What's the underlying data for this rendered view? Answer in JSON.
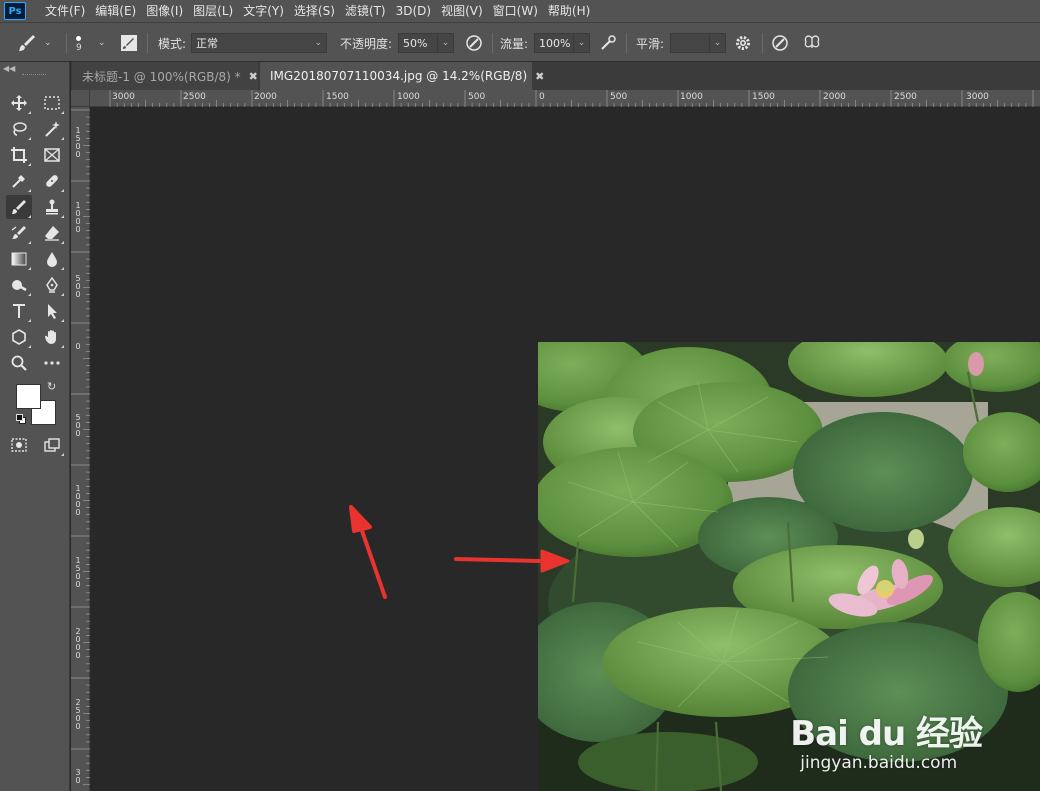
{
  "app": {
    "logo": "Ps"
  },
  "menu": [
    "文件(F)",
    "编辑(E)",
    "图像(I)",
    "图层(L)",
    "文字(Y)",
    "选择(S)",
    "滤镜(T)",
    "3D(D)",
    "视图(V)",
    "窗口(W)",
    "帮助(H)"
  ],
  "options": {
    "brush_size": "9",
    "mode_label": "模式:",
    "mode_value": "正常",
    "opacity_label": "不透明度:",
    "opacity_value": "50%",
    "flow_label": "流量:",
    "flow_value": "100%",
    "smooth_label": "平滑:",
    "smooth_value": ""
  },
  "tabs": [
    {
      "label": "未标题-1 @ 100%(RGB/8) *",
      "active": false
    },
    {
      "label": "IMG20180707110034.jpg @ 14.2%(RGB/8)",
      "active": true
    }
  ],
  "ruler_h_labels": [
    "3000",
    "2500",
    "2000",
    "1500",
    "1000",
    "500",
    "0",
    "500",
    "1000",
    "1500",
    "2000",
    "2500",
    "3000"
  ],
  "ruler_v_labels": [
    "1\n5\n0\n0",
    "1\n0\n0\n0",
    "5\n0\n0",
    "0",
    "5\n0\n0",
    "1\n0\n0\n0",
    "1\n5\n0\n0",
    "2\n0\n0\n0",
    "2\n5\n0\n0",
    "3\n0"
  ],
  "watermark": {
    "brand": "Bai du 经验",
    "url": "jingyan.baidu.com"
  },
  "colors": {
    "panel": "#535353",
    "canvas": "#282828",
    "annotation_arrow": "#e8332e"
  },
  "icons": {
    "move": "move-icon",
    "marquee": "marquee-icon",
    "lasso": "lasso-icon",
    "magic_wand": "magic-wand-icon",
    "crop": "crop-icon",
    "frame": "frame-icon",
    "eyedropper": "eyedropper-icon",
    "healing": "healing-icon",
    "brush": "brush-icon",
    "stamp": "clone-stamp-icon",
    "history_brush": "history-brush-icon",
    "eraser": "eraser-icon",
    "gradient": "gradient-icon",
    "blur": "blur-icon",
    "dodge": "dodge-icon",
    "pen": "pen-icon",
    "type": "type-icon",
    "path_select": "path-select-icon",
    "shape": "shape-icon",
    "hand": "hand-icon",
    "zoom": "zoom-icon",
    "more": "more-icon"
  }
}
